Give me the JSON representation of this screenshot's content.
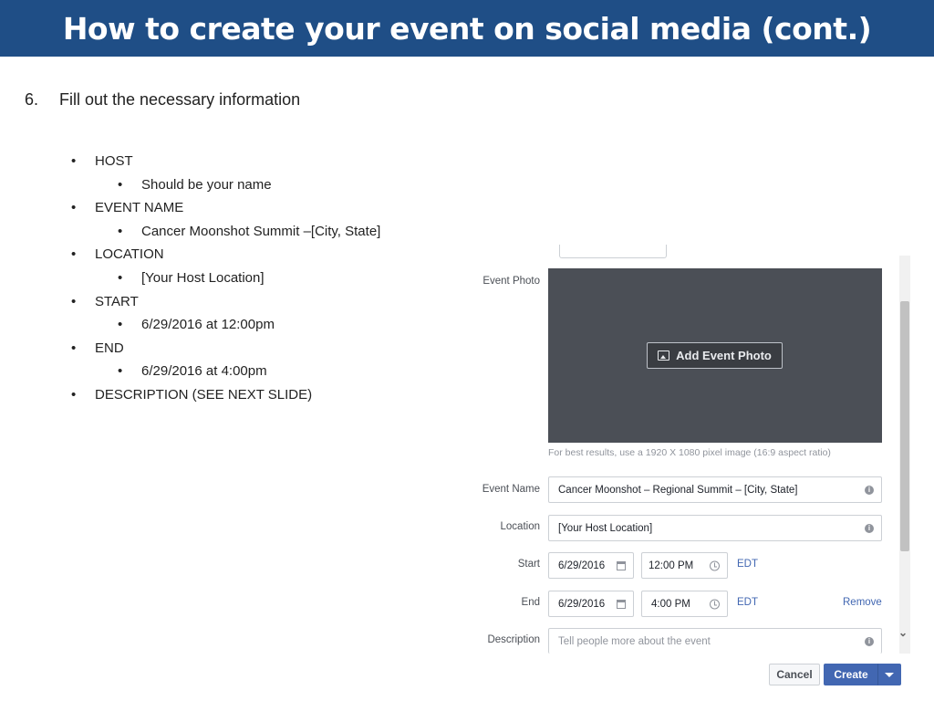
{
  "slide": {
    "title": "How to create your event on social media (cont.)",
    "step_number": "6.",
    "step_text": "Fill out the necessary information",
    "bullets": [
      {
        "level": 1,
        "text": "HOST"
      },
      {
        "level": 2,
        "text": "Should be your name"
      },
      {
        "level": 1,
        "text": "EVENT NAME"
      },
      {
        "level": 2,
        "text": "Cancer Moonshot Summit –[City, State]"
      },
      {
        "level": 1,
        "text": "LOCATION"
      },
      {
        "level": 2,
        "text": "[Your Host Location]"
      },
      {
        "level": 1,
        "text": "START"
      },
      {
        "level": 2,
        "text": "6/29/2016 at 12:00pm"
      },
      {
        "level": 1,
        "text": "END"
      },
      {
        "level": 2,
        "text": "6/29/2016 at 4:00pm"
      },
      {
        "level": 1,
        "text": "DESCRIPTION (SEE NEXT SLIDE)"
      }
    ],
    "bullet_glyph": "•"
  },
  "form": {
    "event_photo_label": "Event Photo",
    "add_photo_label": "Add Event Photo",
    "photo_hint": "For best results, use a 1920 X 1080 pixel image (16:9 aspect ratio)",
    "event_name_label": "Event Name",
    "event_name_value": "Cancer Moonshot – Regional Summit – [City, State]",
    "location_label": "Location",
    "location_value": "[Your Host Location]",
    "start_label": "Start",
    "start_date": "6/29/2016",
    "start_time": "12:00 PM",
    "end_label": "End",
    "end_date": "6/29/2016",
    "end_time": "4:00 PM",
    "timezone": "EDT",
    "remove_label": "Remove",
    "description_label": "Description",
    "description_placeholder": "Tell people more about the event",
    "info_glyph": "i",
    "cancel_label": "Cancel",
    "create_label": "Create",
    "scroll_down_glyph": "⌄"
  },
  "colors": {
    "title_bar": "#1f4e86",
    "fb_blue": "#4267b2",
    "photo_bg": "#4b4f56"
  }
}
